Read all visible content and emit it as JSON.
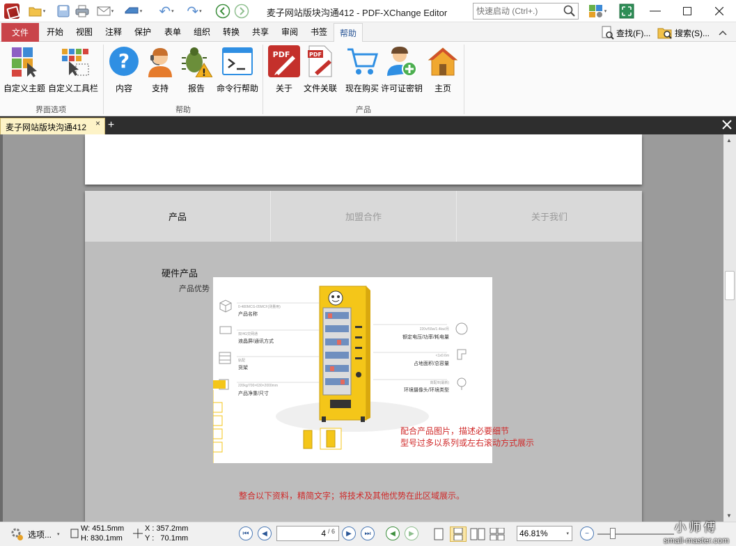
{
  "window": {
    "title": "麦子网站版块沟通412 - PDF-XChange Editor",
    "quick_search_placeholder": "快速启动 (Ctrl+.)"
  },
  "ribbon_tabs": {
    "file": "文件",
    "tabs": [
      "开始",
      "视图",
      "注释",
      "保护",
      "表单",
      "组织",
      "转换",
      "共享",
      "审阅",
      "书签"
    ],
    "active": "帮助",
    "find": "查找(F)...",
    "search": "搜索(S)..."
  },
  "ribbon": {
    "group1_label": "界面选项",
    "group2_label": "帮助",
    "group3_label": "产品",
    "buttons": {
      "custom_theme": "自定义主题",
      "custom_toolbar": "自定义工具栏",
      "contents": "内容",
      "support": "支持",
      "report": "报告",
      "cmdline_help": "命令行帮助",
      "about": "关于",
      "file_assoc": "文件关联",
      "buy_now": "现在购买",
      "license_key": "许可证密钥",
      "home": "主页"
    },
    "icons": {
      "custom_theme": "palette-cursor-icon",
      "custom_toolbar": "toolbar-grid-icon",
      "contents": "question-icon",
      "support": "headset-person-icon",
      "report": "bug-warning-icon",
      "cmdline_help": "terminal-icon",
      "about": "pdf-about-icon",
      "file_assoc": "pdf-file-icon",
      "buy_now": "shopping-cart-icon",
      "license_key": "user-add-icon",
      "home": "home-icon"
    }
  },
  "doc_tab": {
    "name": "麦子网站版块沟通412",
    "close": "×",
    "new": "+"
  },
  "document": {
    "nav": [
      "产品",
      "加盟合作",
      "关于我们"
    ],
    "nav_active": "产品",
    "section_title": "硬件产品",
    "section_sub": "产品优势",
    "spec_left": [
      {
        "small": "0-480MCG-05MCF(测量用)",
        "label": "产品名称"
      },
      {
        "small": "双/4G交网通",
        "label": "液晶屏/通讯方式"
      },
      {
        "small": "轨配",
        "label": "货架"
      },
      {
        "small": "220kg/700×630×2000mm",
        "label": "产品净重/尺寸"
      }
    ],
    "spec_right": [
      {
        "small": "220v/50w/1.4kw/月",
        "label": "额定电压/功率/耗电量"
      },
      {
        "small": "<1x0.6m",
        "label": "占地面积/总容量"
      },
      {
        "small": "高配/8(最新)",
        "label": "环境摄像头/环境类型"
      }
    ],
    "note1": "配合产品图片，描述必要细节",
    "note2": "型号过多以系列或左右滚动方式展示",
    "note3": "整合以下资料，精简文字；将技术及其他优势在此区域展示。"
  },
  "statusbar": {
    "options": "选项...",
    "w": "W: 451.5mm",
    "h": "H: 830.1mm",
    "x": "X : 357.2mm",
    "y": "Y :   70.1mm",
    "page_current": "4",
    "page_total": "/ 6",
    "zoom": "46.81%"
  },
  "watermark": {
    "line1": "小师傅",
    "line2": "small-master.com"
  },
  "colors": {
    "file_tab": "#c9444a",
    "accent_blue": "#2b5797",
    "doc_tab": "#fdf3c7",
    "note_red": "#d02a2a",
    "product_yellow": "#f4c619"
  }
}
